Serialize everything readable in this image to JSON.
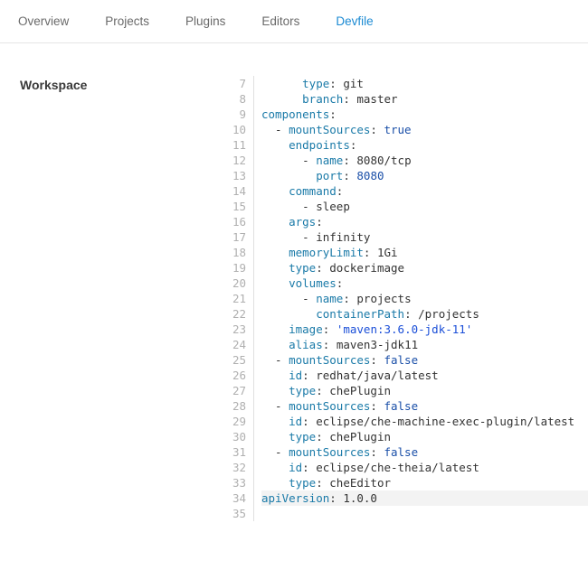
{
  "tabs": [
    {
      "label": "Overview",
      "active": false
    },
    {
      "label": "Projects",
      "active": false
    },
    {
      "label": "Plugins",
      "active": false
    },
    {
      "label": "Editors",
      "active": false
    },
    {
      "label": "Devfile",
      "active": true
    }
  ],
  "sidebar": {
    "title": "Workspace"
  },
  "editor": {
    "firstLineNumber": 7,
    "highlightLine": 34,
    "lines": [
      [
        [
          "      ",
          ""
        ],
        [
          "type",
          ".k"
        ],
        [
          ": ",
          ""
        ],
        [
          "git",
          ""
        ]
      ],
      [
        [
          "      ",
          ""
        ],
        [
          "branch",
          ".k"
        ],
        [
          ": ",
          ""
        ],
        [
          "master",
          ""
        ]
      ],
      [
        [
          "components",
          ".k"
        ],
        [
          ":",
          ""
        ]
      ],
      [
        [
          "  - ",
          ""
        ],
        [
          "mountSources",
          ".k"
        ],
        [
          ": ",
          ""
        ],
        [
          "true",
          ".b"
        ]
      ],
      [
        [
          "    ",
          ""
        ],
        [
          "endpoints",
          ".k"
        ],
        [
          ":",
          ""
        ]
      ],
      [
        [
          "      - ",
          ""
        ],
        [
          "name",
          ".k"
        ],
        [
          ": ",
          ""
        ],
        [
          "8080/tcp",
          ""
        ]
      ],
      [
        [
          "        ",
          ""
        ],
        [
          "port",
          ".k"
        ],
        [
          ": ",
          ""
        ],
        [
          "8080",
          ".b"
        ]
      ],
      [
        [
          "    ",
          ""
        ],
        [
          "command",
          ".k"
        ],
        [
          ":",
          ""
        ]
      ],
      [
        [
          "      - ",
          ""
        ],
        [
          "sleep",
          ""
        ]
      ],
      [
        [
          "    ",
          ""
        ],
        [
          "args",
          ".k"
        ],
        [
          ":",
          ""
        ]
      ],
      [
        [
          "      - ",
          ""
        ],
        [
          "infinity",
          ""
        ]
      ],
      [
        [
          "    ",
          ""
        ],
        [
          "memoryLimit",
          ".k"
        ],
        [
          ": ",
          ""
        ],
        [
          "1Gi",
          ""
        ]
      ],
      [
        [
          "    ",
          ""
        ],
        [
          "type",
          ".k"
        ],
        [
          ": ",
          ""
        ],
        [
          "dockerimage",
          ""
        ]
      ],
      [
        [
          "    ",
          ""
        ],
        [
          "volumes",
          ".k"
        ],
        [
          ":",
          ""
        ]
      ],
      [
        [
          "      - ",
          ""
        ],
        [
          "name",
          ".k"
        ],
        [
          ": ",
          ""
        ],
        [
          "projects",
          ""
        ]
      ],
      [
        [
          "        ",
          ""
        ],
        [
          "containerPath",
          ".k"
        ],
        [
          ": ",
          ""
        ],
        [
          "/projects",
          ""
        ]
      ],
      [
        [
          "    ",
          ""
        ],
        [
          "image",
          ".k"
        ],
        [
          ": ",
          ""
        ],
        [
          "'maven:3.6.0-jdk-11'",
          ".q"
        ]
      ],
      [
        [
          "    ",
          ""
        ],
        [
          "alias",
          ".k"
        ],
        [
          ": ",
          ""
        ],
        [
          "maven3-jdk11",
          ""
        ]
      ],
      [
        [
          "  - ",
          ""
        ],
        [
          "mountSources",
          ".k"
        ],
        [
          ": ",
          ""
        ],
        [
          "false",
          ".b"
        ]
      ],
      [
        [
          "    ",
          ""
        ],
        [
          "id",
          ".k"
        ],
        [
          ": ",
          ""
        ],
        [
          "redhat/java/latest",
          ""
        ]
      ],
      [
        [
          "    ",
          ""
        ],
        [
          "type",
          ".k"
        ],
        [
          ": ",
          ""
        ],
        [
          "chePlugin",
          ""
        ]
      ],
      [
        [
          "  - ",
          ""
        ],
        [
          "mountSources",
          ".k"
        ],
        [
          ": ",
          ""
        ],
        [
          "false",
          ".b"
        ]
      ],
      [
        [
          "    ",
          ""
        ],
        [
          "id",
          ".k"
        ],
        [
          ": ",
          ""
        ],
        [
          "eclipse/che-machine-exec-plugin/latest",
          ""
        ]
      ],
      [
        [
          "    ",
          ""
        ],
        [
          "type",
          ".k"
        ],
        [
          ": ",
          ""
        ],
        [
          "chePlugin",
          ""
        ]
      ],
      [
        [
          "  - ",
          ""
        ],
        [
          "mountSources",
          ".k"
        ],
        [
          ": ",
          ""
        ],
        [
          "false",
          ".b"
        ]
      ],
      [
        [
          "    ",
          ""
        ],
        [
          "id",
          ".k"
        ],
        [
          ": ",
          ""
        ],
        [
          "eclipse/che-theia/latest",
          ""
        ]
      ],
      [
        [
          "    ",
          ""
        ],
        [
          "type",
          ".k"
        ],
        [
          ": ",
          ""
        ],
        [
          "cheEditor",
          ""
        ]
      ],
      [
        [
          "apiVersion",
          ".k"
        ],
        [
          ": ",
          ""
        ],
        [
          "1.0.0",
          ""
        ]
      ],
      [
        [
          "",
          ""
        ]
      ]
    ]
  }
}
